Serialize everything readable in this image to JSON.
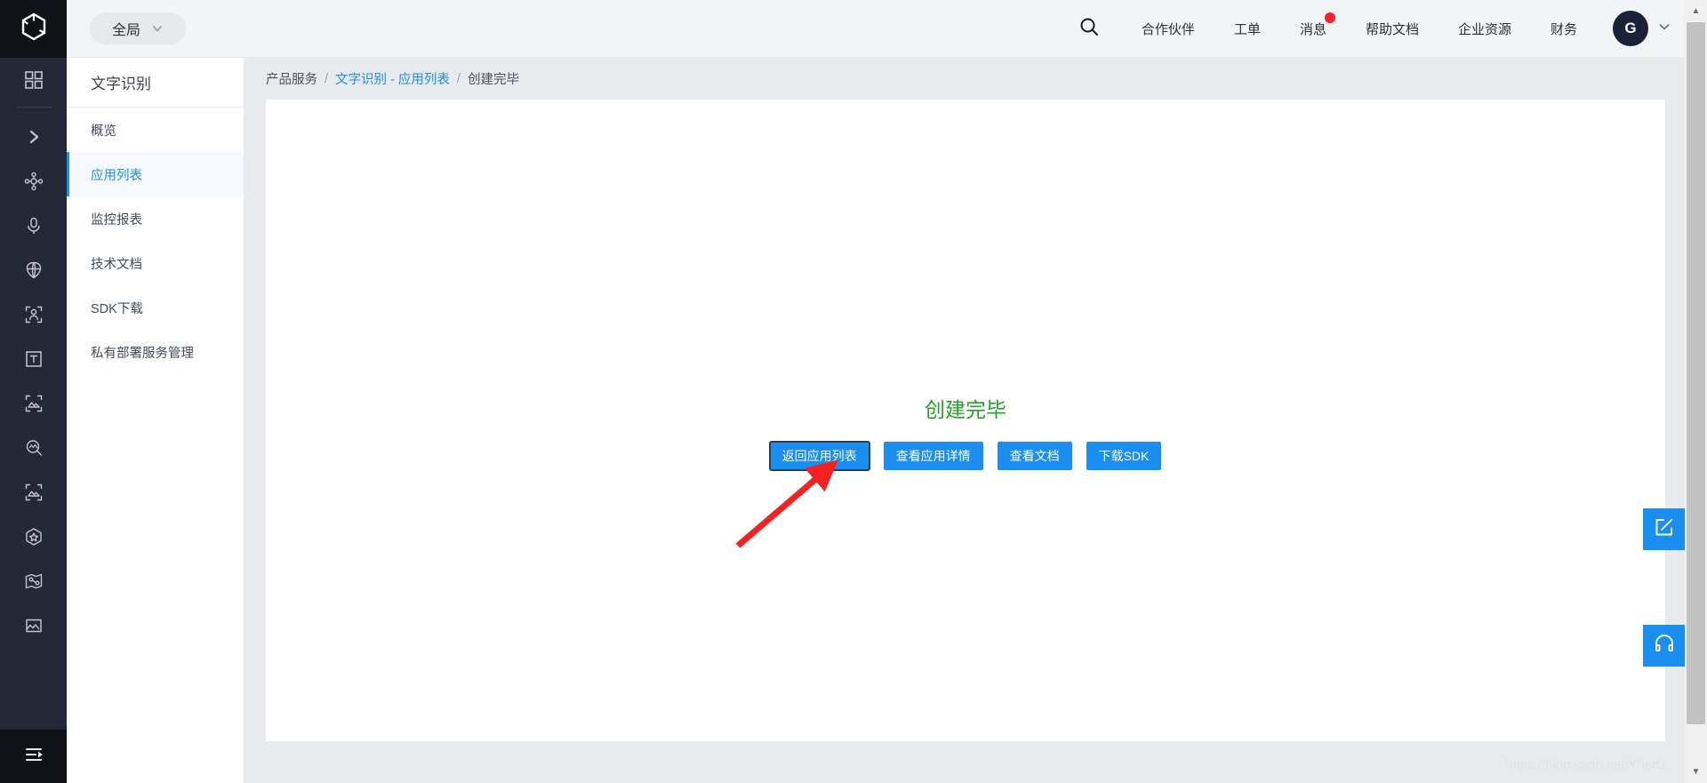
{
  "header": {
    "scope_label": "全局",
    "scope_icon": "chevron-down-icon",
    "search_icon": "search-icon",
    "nav_items": [
      {
        "label": "合作伙伴",
        "badge": false
      },
      {
        "label": "工单",
        "badge": false
      },
      {
        "label": "消息",
        "badge": true
      },
      {
        "label": "帮助文档",
        "badge": false
      },
      {
        "label": "企业资源",
        "badge": false
      },
      {
        "label": "财务",
        "badge": false
      }
    ],
    "avatar_initial": "G",
    "badge_color": "#f5222d",
    "avatar_color": "#1b2138"
  },
  "icon_rail": {
    "logo_icon": "cube-logo-icon",
    "items": [
      {
        "icon": "grid-apps-icon"
      },
      {
        "icon": "chevron-right-icon"
      },
      {
        "icon": "network-nodes-icon"
      },
      {
        "icon": "microphone-icon"
      },
      {
        "icon": "globe-shield-icon"
      },
      {
        "icon": "face-scan-icon"
      },
      {
        "icon": "text-recognition-icon"
      },
      {
        "icon": "image-scan-icon"
      },
      {
        "icon": "image-search-icon"
      },
      {
        "icon": "image-scan-alt-icon"
      },
      {
        "icon": "cube-3d-icon"
      },
      {
        "icon": "map-route-icon"
      },
      {
        "icon": "picture-icon"
      }
    ],
    "bottom_icon": "collapse-panel-icon"
  },
  "subnav": {
    "title": "文字识别",
    "items": [
      {
        "label": "概览",
        "active": false
      },
      {
        "label": "应用列表",
        "active": true
      },
      {
        "label": "监控报表",
        "active": false
      },
      {
        "label": "技术文档",
        "active": false
      },
      {
        "label": "SDK下载",
        "active": false
      },
      {
        "label": "私有部署服务管理",
        "active": false
      }
    ],
    "active_color": "#1b8ef2"
  },
  "breadcrumb": {
    "items": [
      {
        "label": "产品服务",
        "link": false
      },
      {
        "label": "文字识别 - 应用列表",
        "link": true
      },
      {
        "label": "创建完毕",
        "link": false
      }
    ],
    "separator": "/"
  },
  "main": {
    "result_title": "创建完毕",
    "result_title_color": "#26a126",
    "buttons": [
      {
        "label": "返回应用列表",
        "focused": true
      },
      {
        "label": "查看应用详情",
        "focused": false
      },
      {
        "label": "查看文档",
        "focused": false
      },
      {
        "label": "下载SDK",
        "focused": false
      }
    ],
    "button_color": "#1b8ef2"
  },
  "float_buttons": [
    {
      "icon": "edit-feedback-icon",
      "name": "feedback-button"
    },
    {
      "icon": "headset-support-icon",
      "name": "support-button"
    }
  ],
  "scrollbar": {
    "up_arrow": "▲",
    "down_arrow": "▼"
  },
  "annotation": {
    "arrow_color": "#f52020"
  },
  "watermark": {
    "text": "https://blog.csdn.net/Yhen1"
  }
}
